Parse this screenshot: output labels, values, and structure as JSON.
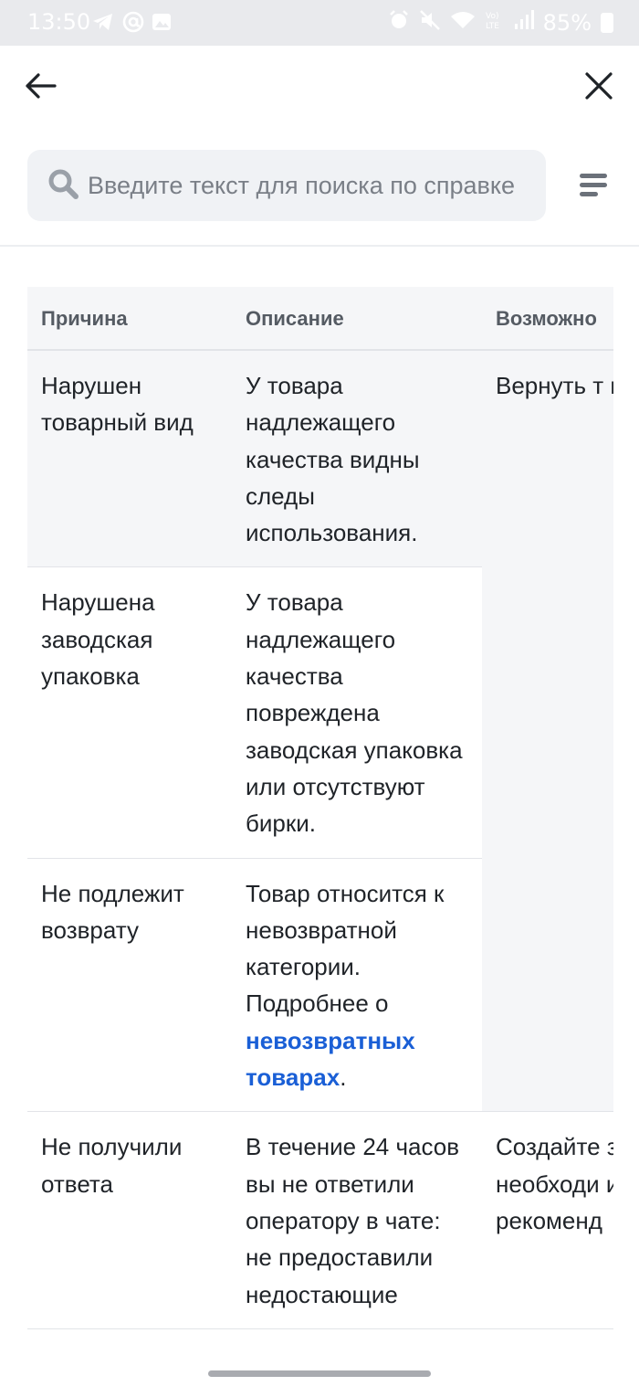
{
  "status_bar": {
    "time": "13:50",
    "battery": "85%",
    "icons_left": [
      "telegram-icon",
      "at-icon",
      "image-icon"
    ],
    "icons_right": [
      "alarm-icon",
      "mute-icon",
      "wifi-icon",
      "volte-icon",
      "signal-icon",
      "battery-icon"
    ]
  },
  "search": {
    "placeholder": "Введите текст для поиска по справке"
  },
  "table": {
    "headers": [
      "Причина",
      "Описание",
      "Возможно"
    ],
    "rows": [
      {
        "reason": "Нарушен товарный вид",
        "description": "У товара надлежащего качества видны следы использования."
      },
      {
        "reason": "Нарушена заводская упаковка",
        "description": "У товара надлежащего качества повреждена заводская упаковка или отсутствуют бирки."
      },
      {
        "reason": "Не подлежит возврату",
        "description_prefix": "Товар относится к невозвратной категории. Подробнее о ",
        "description_link": "невозвратных товарах",
        "description_suffix": "."
      },
      {
        "reason": "Не получили ответа",
        "description": "В течение 24 часов вы не ответили оператору в чате: не предоставили недостающие",
        "possible": "Создайте заявку со необходи информац рекоменд"
      }
    ],
    "merged_possible": "Вернуть т получится"
  },
  "colors": {
    "accent_link": "#1a5fd6",
    "header_bg": "#f5f6f8",
    "search_bg": "#f0f2f5"
  }
}
